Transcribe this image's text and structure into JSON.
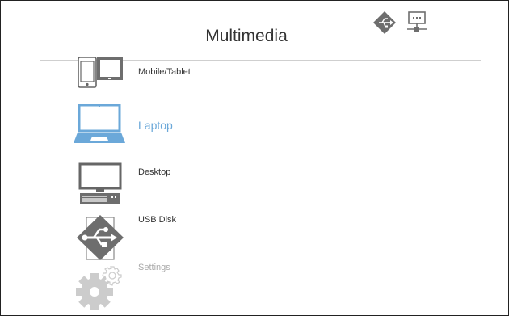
{
  "header": {
    "title": "Multimedia",
    "status_icons": [
      "usb-diamond-icon",
      "network-icon"
    ]
  },
  "menu": {
    "selected_index": 1,
    "items": [
      {
        "label": "Mobile/Tablet",
        "icon": "mobile-tablet-icon",
        "state": "normal"
      },
      {
        "label": "Laptop",
        "icon": "laptop-icon",
        "state": "selected"
      },
      {
        "label": "Desktop",
        "icon": "desktop-icon",
        "state": "normal"
      },
      {
        "label": "USB Disk",
        "icon": "usb-disk-icon",
        "state": "normal"
      },
      {
        "label": "Settings",
        "icon": "settings-gear-icon",
        "state": "disabled"
      }
    ]
  },
  "colors": {
    "accent": "#6ba8d9",
    "icon_gray": "#666666",
    "disabled_gray": "#cccccc",
    "divider": "#cfcfcf"
  }
}
